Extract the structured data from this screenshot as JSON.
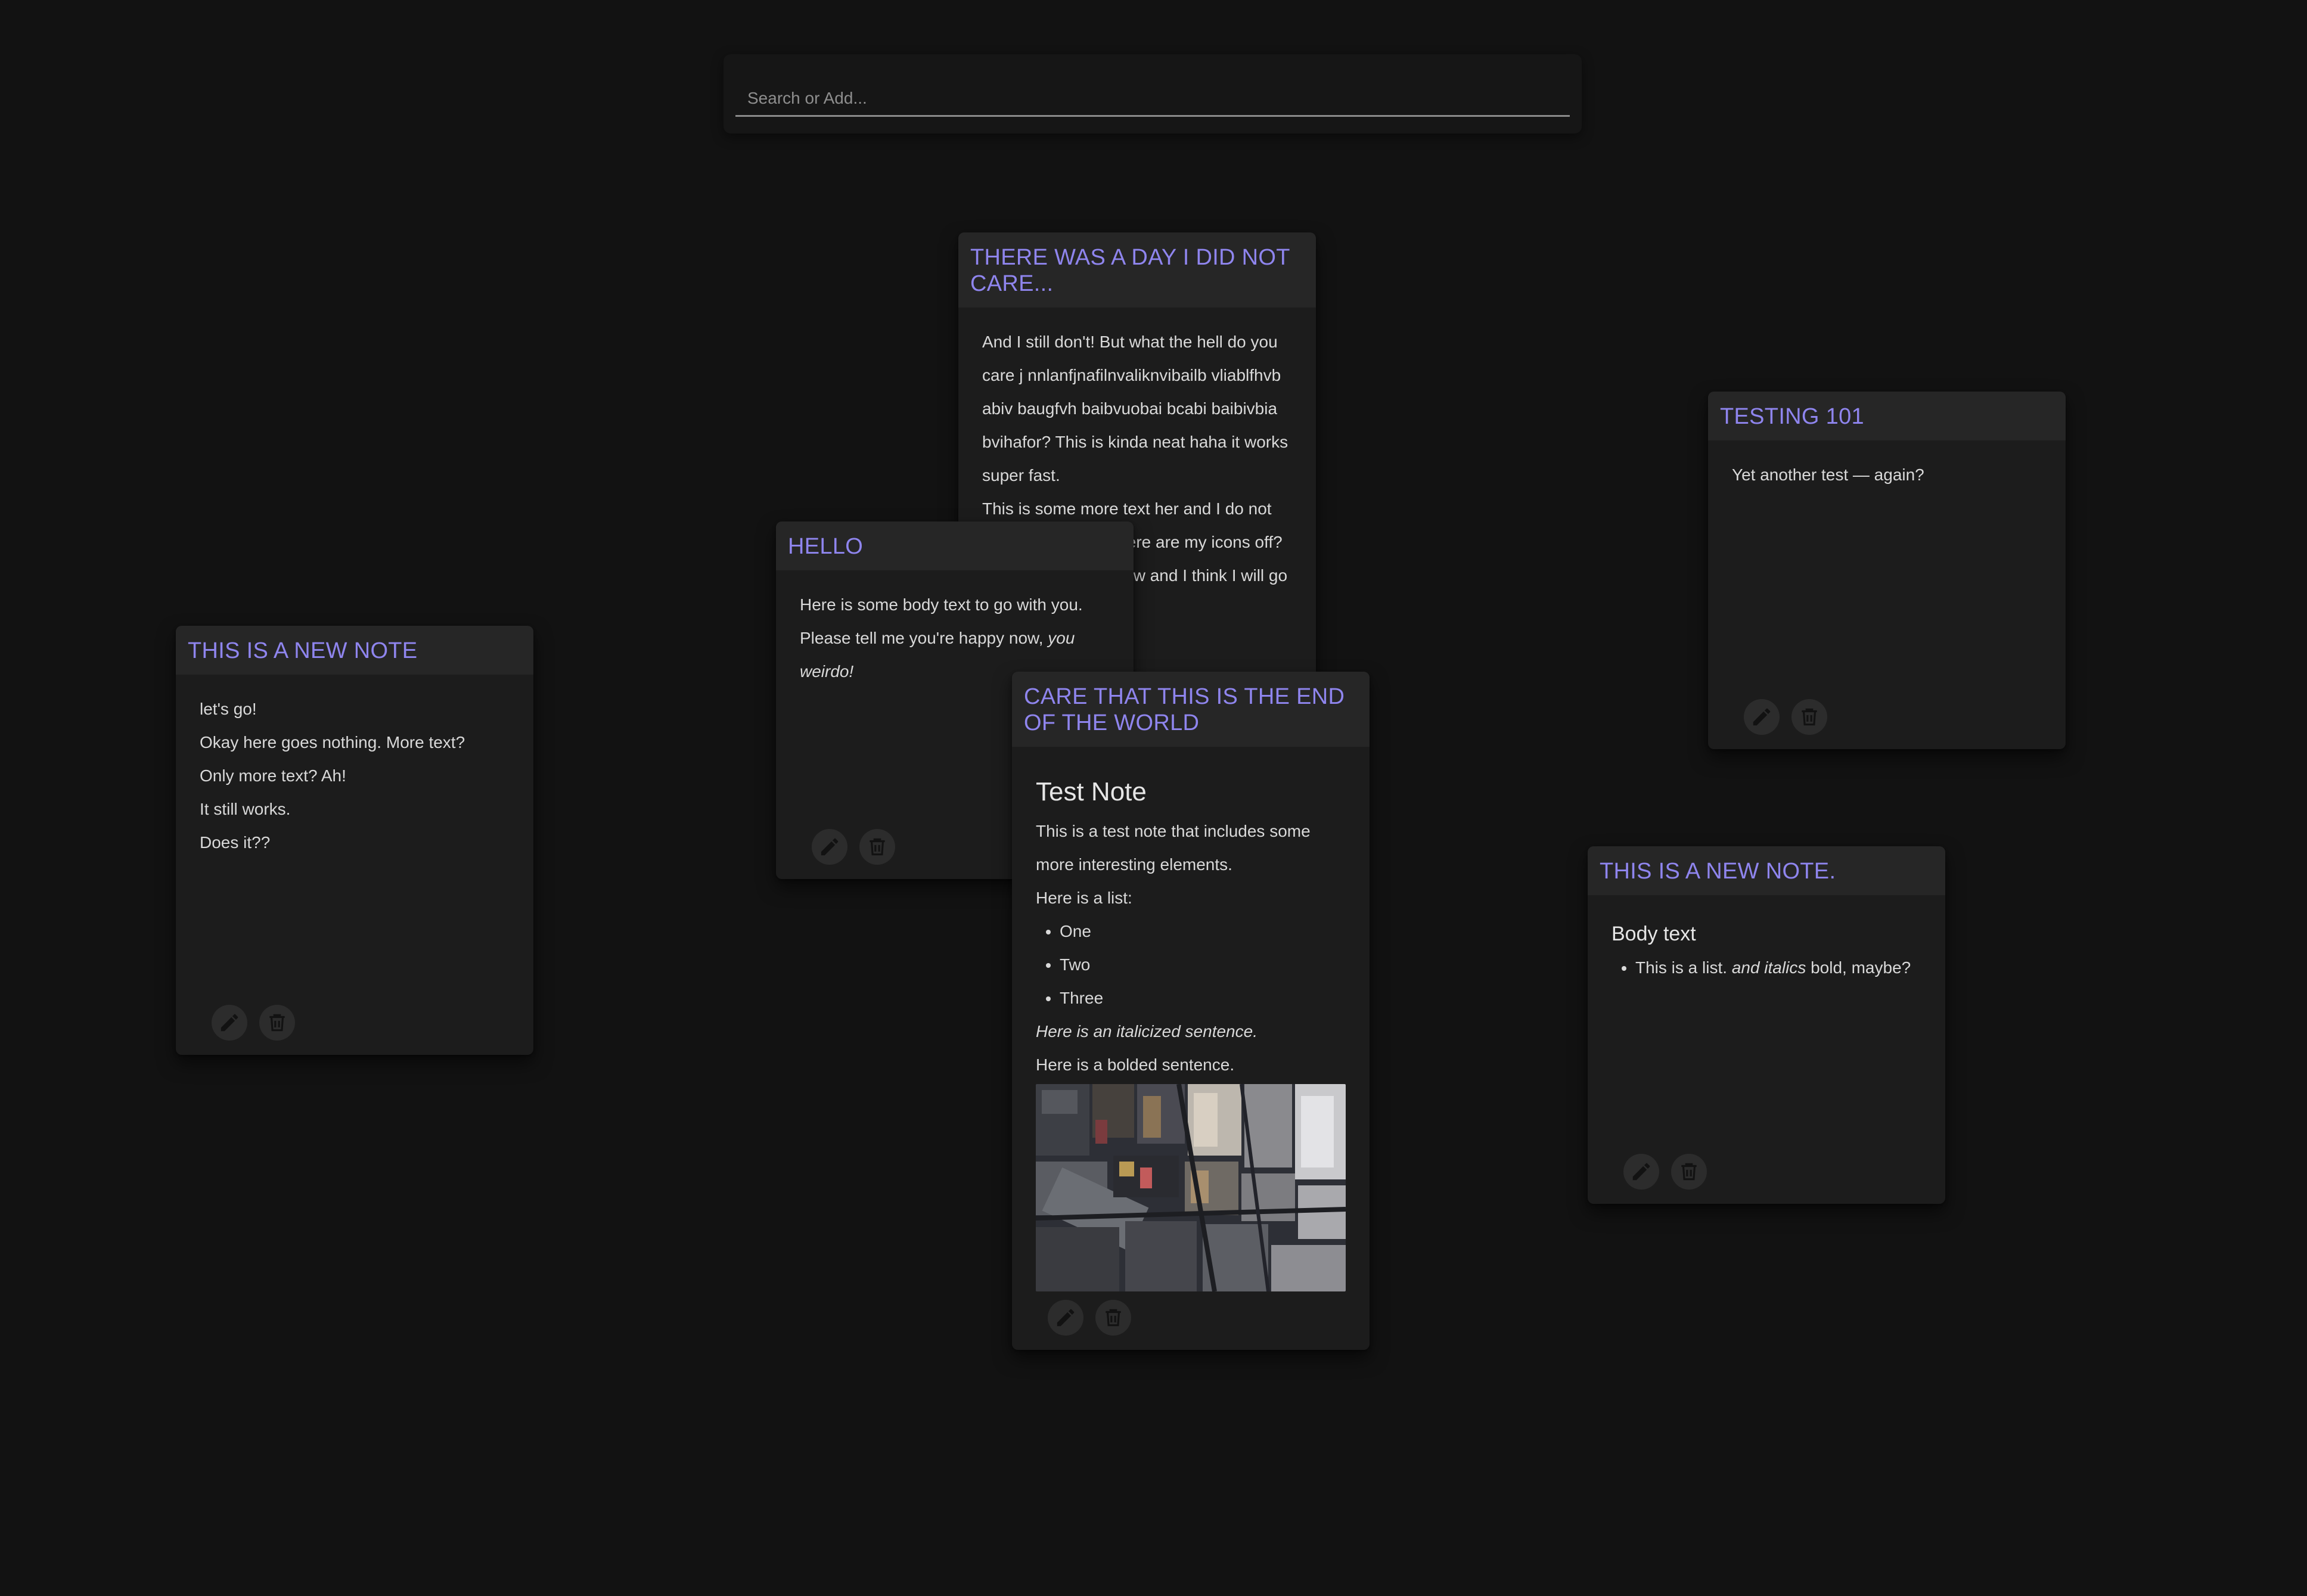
{
  "search": {
    "placeholder": "Search or Add..."
  },
  "theme": {
    "background": "#121212",
    "card": "#1c1c1c",
    "card_header": "#262626",
    "accent": "#8f85ee"
  },
  "icons": {
    "edit": "pencil-icon",
    "delete": "trash-icon"
  },
  "notes": [
    {
      "title": "There was a day I did not care...",
      "body": [
        "And I still don't! But what the hell do you care j nnlanfjnafilnvaliknvibailb vliablfhvb abiv baugfvh baibvuobai bcabi baibivbia bvihafor? This is kinda neat haha it works super fast.",
        "This is some more text her and I do not care that much. Where are my icons off? Ah they are there now and I think I will go to bed."
      ]
    },
    {
      "title": "Testing 101",
      "body": [
        "Yet another test — again?"
      ]
    },
    {
      "title": "Hello",
      "body_plain": "Here is some body text to go with you. Please tell me you're happy now, ",
      "body_italic": "you weirdo!"
    },
    {
      "title": "This is a new note",
      "body": [
        "let's go!",
        "Okay here goes nothing. More text?",
        "Only more text? Ah!",
        "It still works.",
        "Does it??"
      ]
    },
    {
      "title": "Care that this is the end of the world",
      "heading": "Test Note",
      "intro": "This is a test note that includes some more interesting elements.",
      "list_label": "Here is a list:",
      "list": [
        "One",
        "Two",
        "Three"
      ],
      "italic_sentence": "Here is an italicized sentence.",
      "bold_sentence": "Here is a bolded sentence."
    },
    {
      "title": "This is a new note.",
      "heading": "Body text",
      "list_plain": "This is a list. ",
      "list_italic": "and italics",
      "list_tail": " bold, maybe?"
    }
  ]
}
